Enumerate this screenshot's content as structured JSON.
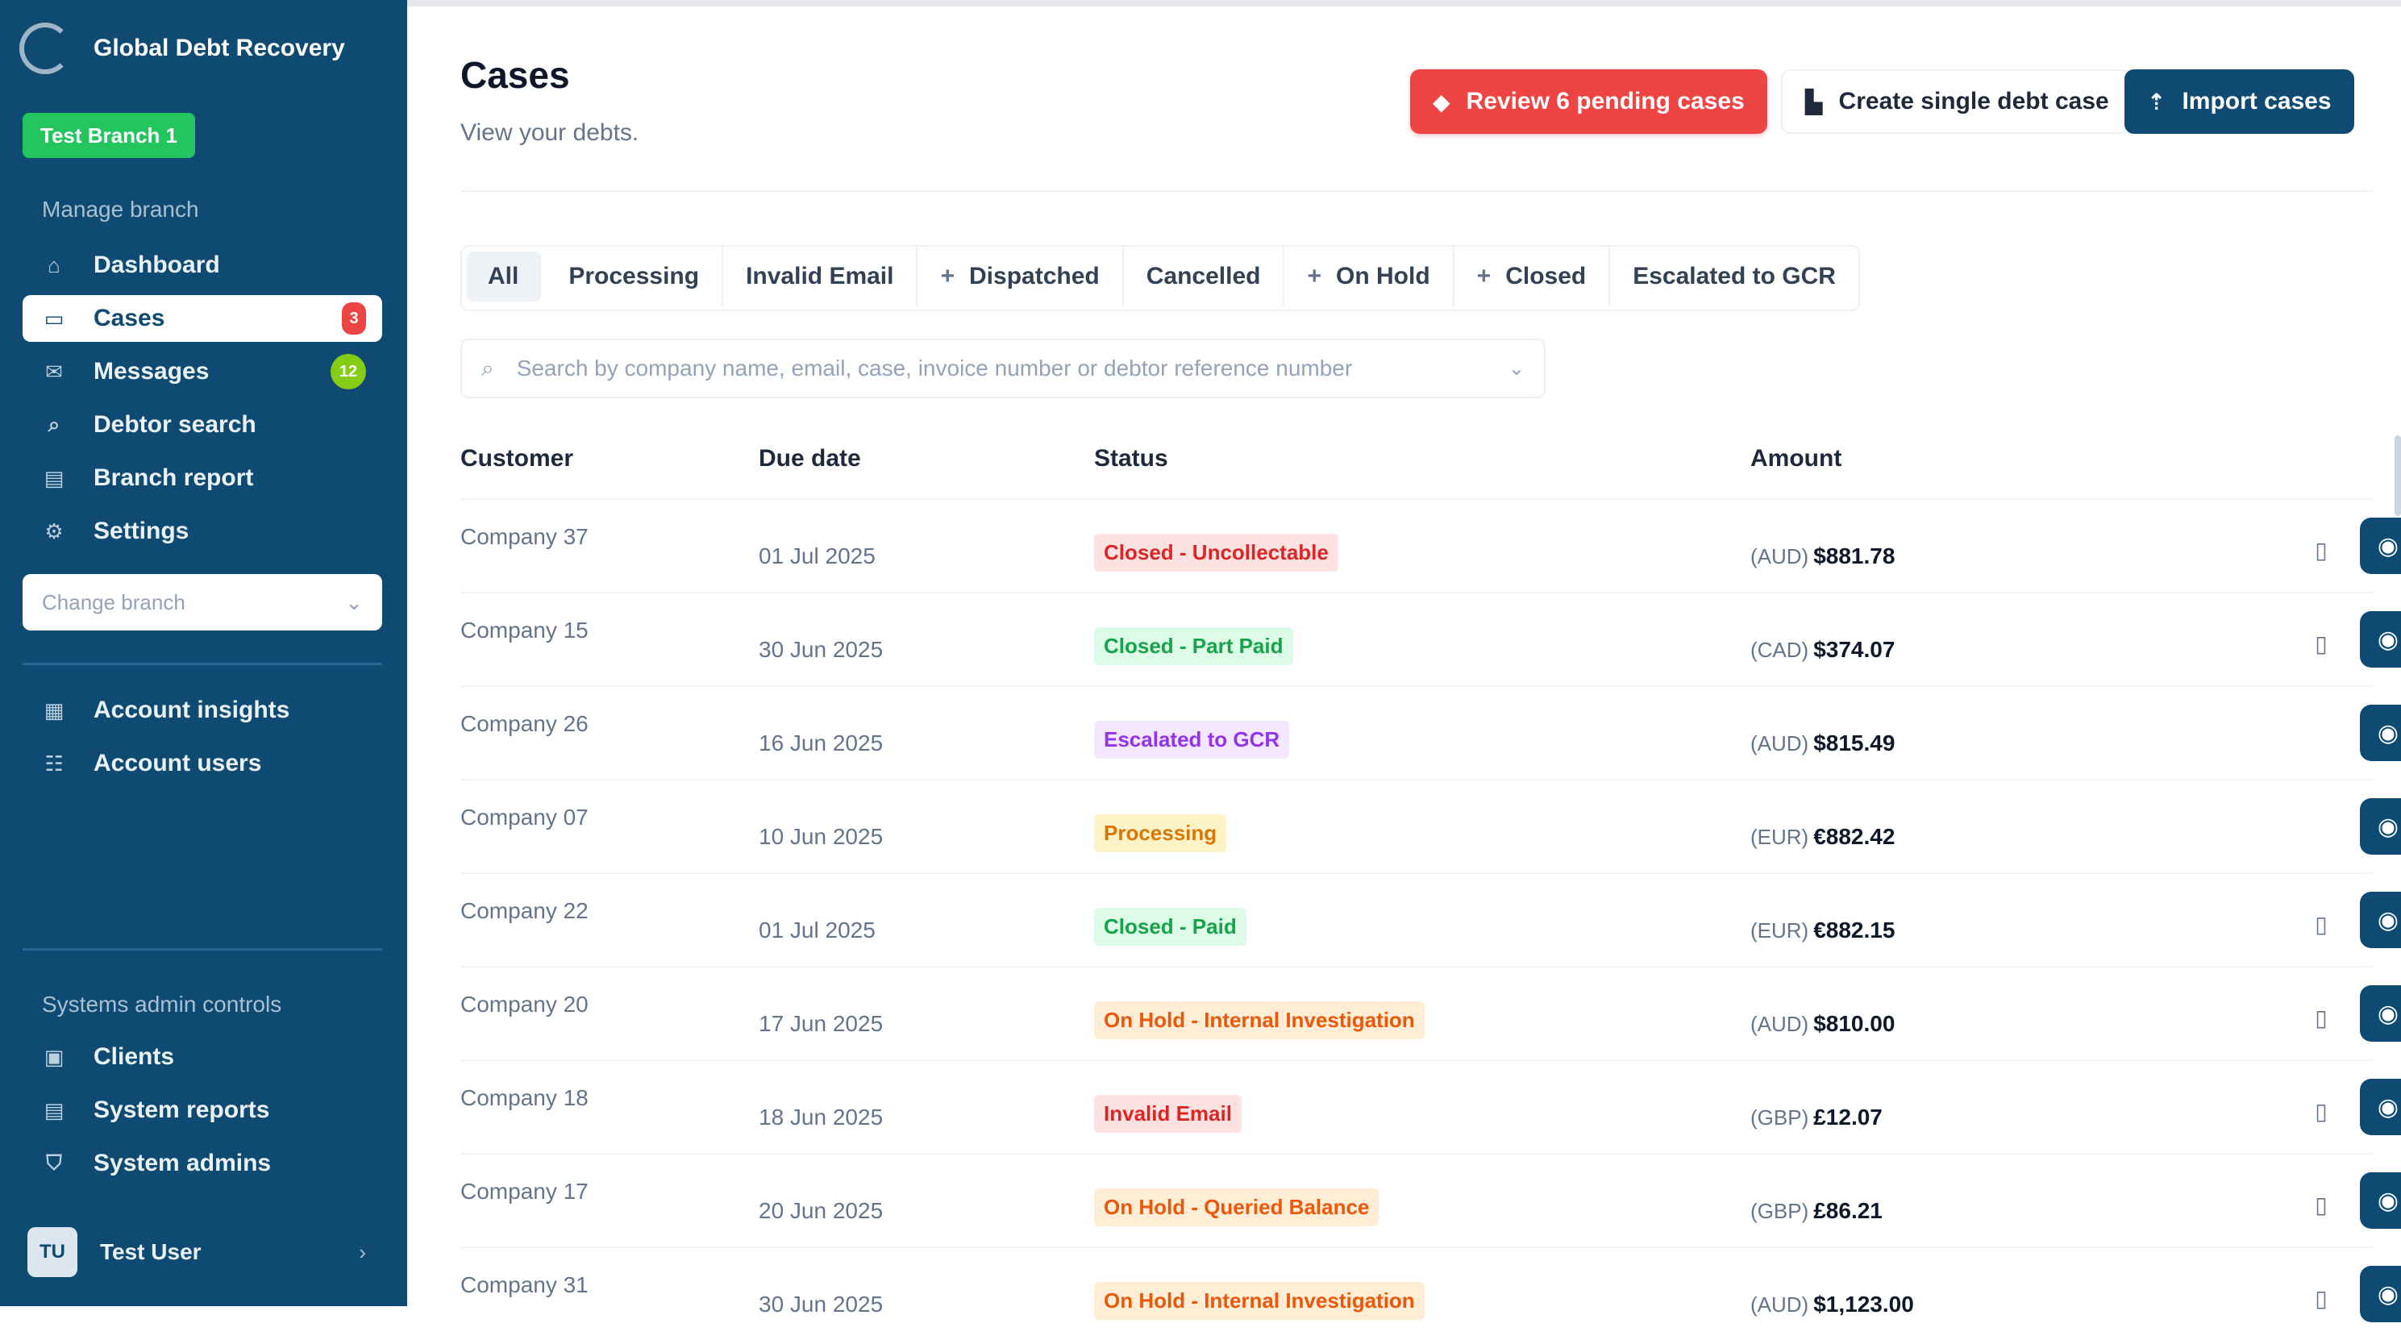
{
  "sidebar": {
    "brand": "Global Debt Recovery",
    "branch_badge": "Test Branch 1",
    "manage_label": "Manage branch",
    "items": [
      {
        "label": "Dashboard",
        "icon": "home-icon"
      },
      {
        "label": "Cases",
        "icon": "folder-icon",
        "badge": "3"
      },
      {
        "label": "Messages",
        "icon": "mail-icon",
        "badge": "12"
      },
      {
        "label": "Debtor search",
        "icon": "search-icon"
      },
      {
        "label": "Branch report",
        "icon": "report-icon"
      },
      {
        "label": "Settings",
        "icon": "gear-icon"
      }
    ],
    "change_branch_placeholder": "Change branch",
    "account_items": [
      {
        "label": "Account insights",
        "icon": "chart-icon"
      },
      {
        "label": "Account users",
        "icon": "users-icon"
      }
    ],
    "admin_label": "Systems admin controls",
    "admin_items": [
      {
        "label": "Clients",
        "icon": "clients-icon"
      },
      {
        "label": "System reports",
        "icon": "report-icon"
      },
      {
        "label": "System admins",
        "icon": "shield-icon"
      }
    ],
    "user": {
      "initials": "TU",
      "name": "Test User"
    }
  },
  "header": {
    "title": "Cases",
    "subtitle": "View your debts.",
    "review_button": "Review 6 pending cases",
    "create_button": "Create single debt case",
    "import_button": "Import cases"
  },
  "tabs": [
    {
      "label": "All",
      "plus": false
    },
    {
      "label": "Processing",
      "plus": false
    },
    {
      "label": "Invalid Email",
      "plus": false
    },
    {
      "label": "Dispatched",
      "plus": true
    },
    {
      "label": "Cancelled",
      "plus": false
    },
    {
      "label": "On Hold",
      "plus": true
    },
    {
      "label": "Closed",
      "plus": true
    },
    {
      "label": "Escalated to GCR",
      "plus": false
    }
  ],
  "search": {
    "placeholder": "Search by company name, email, case, invoice number or debtor reference number"
  },
  "table": {
    "columns": [
      "Customer",
      "Due date",
      "Status",
      "Amount"
    ],
    "rows": [
      {
        "customer": "Company 37",
        "due": "01 Jul 2025",
        "status": "Closed - Uncollectable",
        "status_color": "#dc2626",
        "status_bg": "#fde2e2",
        "currency": "(AUD)",
        "amount": "$881.78",
        "doc": true
      },
      {
        "customer": "Company 15",
        "due": "30 Jun 2025",
        "status": "Closed - Part Paid",
        "status_color": "#16a34a",
        "status_bg": "#dcfce7",
        "currency": "(CAD)",
        "amount": "$374.07",
        "doc": true
      },
      {
        "customer": "Company 26",
        "due": "16 Jun 2025",
        "status": "Escalated to GCR",
        "status_color": "#9333ea",
        "status_bg": "#f3e8ff",
        "currency": "(AUD)",
        "amount": "$815.49",
        "doc": false
      },
      {
        "customer": "Company 07",
        "due": "10 Jun 2025",
        "status": "Processing",
        "status_color": "#d97706",
        "status_bg": "#fef3c7",
        "currency": "(EUR)",
        "amount": "€882.42",
        "doc": false
      },
      {
        "customer": "Company 22",
        "due": "01 Jul 2025",
        "status": "Closed - Paid",
        "status_color": "#16a34a",
        "status_bg": "#dcfce7",
        "currency": "(EUR)",
        "amount": "€882.15",
        "doc": true
      },
      {
        "customer": "Company 20",
        "due": "17 Jun 2025",
        "status": "On Hold - Internal Investigation",
        "status_color": "#ea580c",
        "status_bg": "#ffedd5",
        "currency": "(AUD)",
        "amount": "$810.00",
        "doc": true
      },
      {
        "customer": "Company 18",
        "due": "18 Jun 2025",
        "status": "Invalid Email",
        "status_color": "#dc2626",
        "status_bg": "#fde2e2",
        "currency": "(GBP)",
        "amount": "£12.07",
        "doc": true
      },
      {
        "customer": "Company 17",
        "due": "20 Jun 2025",
        "status": "On Hold - Queried Balance",
        "status_color": "#ea580c",
        "status_bg": "#ffedd5",
        "currency": "(GBP)",
        "amount": "£86.21",
        "doc": true
      },
      {
        "customer": "Company 31",
        "due": "30 Jun 2025",
        "status": "On Hold - Internal Investigation",
        "status_color": "#ea580c",
        "status_bg": "#ffedd5",
        "currency": "(AUD)",
        "amount": "$1,123.00",
        "doc": true
      }
    ]
  }
}
